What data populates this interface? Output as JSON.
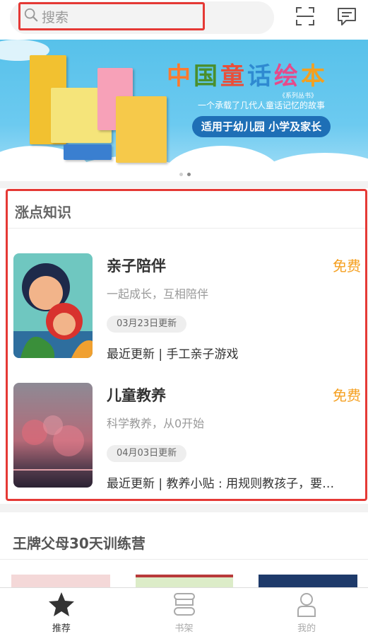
{
  "header": {
    "search_placeholder": "搜索",
    "icons": [
      "search-icon",
      "scan-icon",
      "message-icon"
    ]
  },
  "banner": {
    "title_chars": [
      "中",
      "国",
      "童",
      "话",
      "绘",
      "本"
    ],
    "series_label": "《系列丛书》",
    "subtitle": "一个承载了几代人童话记忆的故事",
    "tag": "适用于幼儿园 小学及家长",
    "slide_count": 2,
    "active_slide": 2
  },
  "knowledge": {
    "title": "涨点知识",
    "courses": [
      {
        "title": "亲子陪伴",
        "price": "免费",
        "desc": "一起成长，互相陪伴",
        "badge": "03月23日更新",
        "update": "最近更新 | 手工亲子游戏"
      },
      {
        "title": "儿童教养",
        "price": "免费",
        "desc": "科学教养，从0开始",
        "badge": "04月03日更新",
        "update": "最近更新 | 教养小贴 : 用规则教孩子，要…"
      }
    ]
  },
  "camp": {
    "title": "王牌父母30天训练营"
  },
  "nav": {
    "items": [
      {
        "label": "推荐",
        "icon": "star-icon",
        "active": true
      },
      {
        "label": "书架",
        "icon": "bookshelf-icon",
        "active": false
      },
      {
        "label": "我的",
        "icon": "profile-icon",
        "active": false
      }
    ]
  },
  "colors": {
    "highlight_border": "#e53935",
    "price": "#f5a021",
    "banner_sky": "#57c1ea"
  }
}
